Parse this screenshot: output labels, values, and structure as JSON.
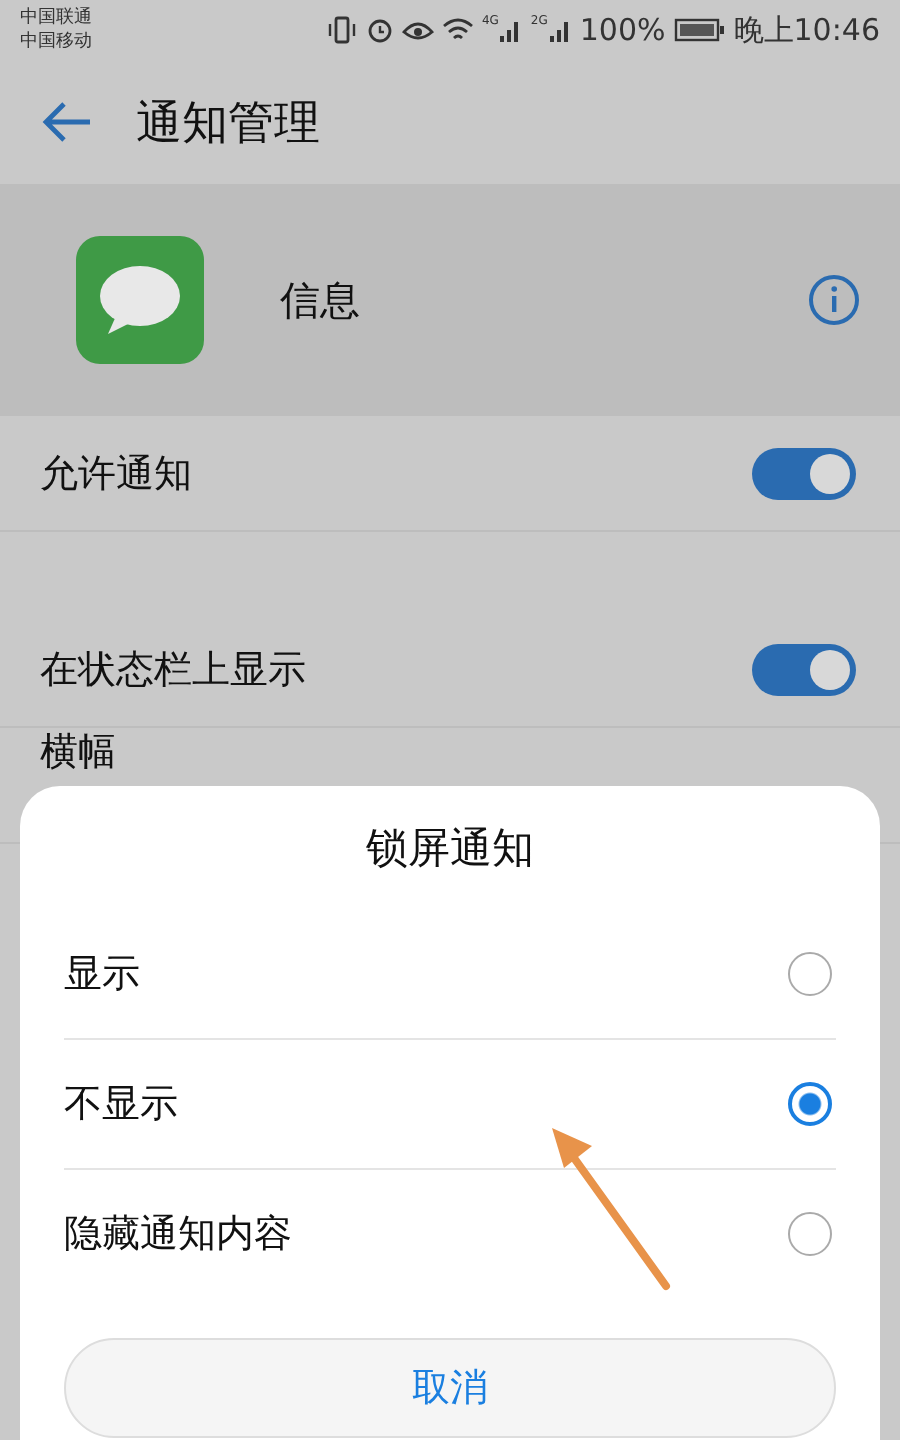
{
  "status_bar": {
    "carriers": [
      "中国联通",
      "中国移动"
    ],
    "networks": [
      "4G",
      "2G"
    ],
    "battery": "100%",
    "time": "晚上10:46"
  },
  "header": {
    "title": "通知管理"
  },
  "app": {
    "name": "信息"
  },
  "setting_groups": [
    [
      {
        "kind": "toggle",
        "label": "允许通知",
        "on": true
      }
    ],
    [
      {
        "kind": "toggle",
        "label": "在状态栏上显示",
        "on": true
      },
      {
        "kind": "plain",
        "label": "横幅"
      }
    ]
  ],
  "sheet": {
    "title": "锁屏通知",
    "options": [
      {
        "label": "显示",
        "selected": false
      },
      {
        "label": "不显示",
        "selected": true
      },
      {
        "label": "隐藏通知内容",
        "selected": false
      }
    ],
    "cancel": "取消"
  }
}
